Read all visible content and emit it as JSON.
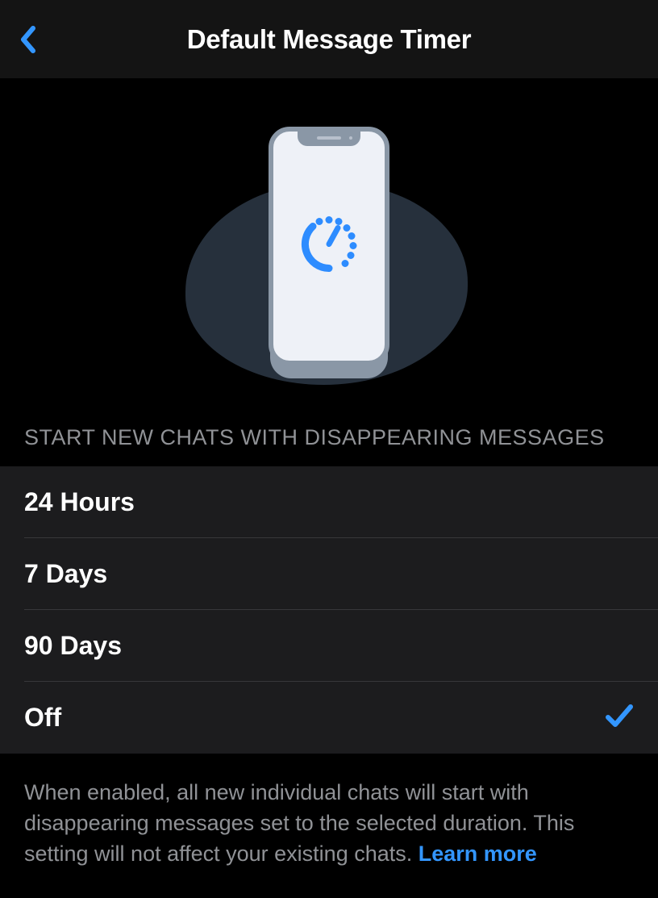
{
  "header": {
    "title": "Default Message Timer"
  },
  "section": {
    "title": "START NEW CHATS WITH DISAPPEARING MESSAGES"
  },
  "options": [
    {
      "label": "24 Hours",
      "selected": false
    },
    {
      "label": "7 Days",
      "selected": false
    },
    {
      "label": "90 Days",
      "selected": false
    },
    {
      "label": "Off",
      "selected": true
    }
  ],
  "footer": {
    "text": "When enabled, all new individual chats will start with disappearing messages set to the selected duration. This setting will not affect your existing chats. ",
    "link": "Learn more"
  }
}
